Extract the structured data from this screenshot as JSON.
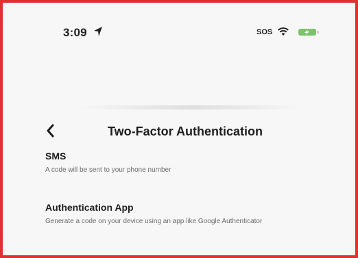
{
  "status_bar": {
    "time": "3:09",
    "carrier_text": "SOS",
    "icons": [
      "location-arrow-icon",
      "wifi-icon",
      "battery-charging-icon"
    ],
    "battery_color": "#7cc36b"
  },
  "header": {
    "title": "Two-Factor Authentication",
    "back_icon": "chevron-left-icon"
  },
  "options": [
    {
      "label": "SMS",
      "description": "A code will be sent to your phone number"
    },
    {
      "label": "Authentication App",
      "description": "Generate a code on your device using an app like Google Authenticator"
    }
  ],
  "colors": {
    "frame_border": "#e03030",
    "background": "#f7f7f7",
    "text_primary": "#1f1f1f",
    "text_secondary": "#6b6b6b"
  }
}
